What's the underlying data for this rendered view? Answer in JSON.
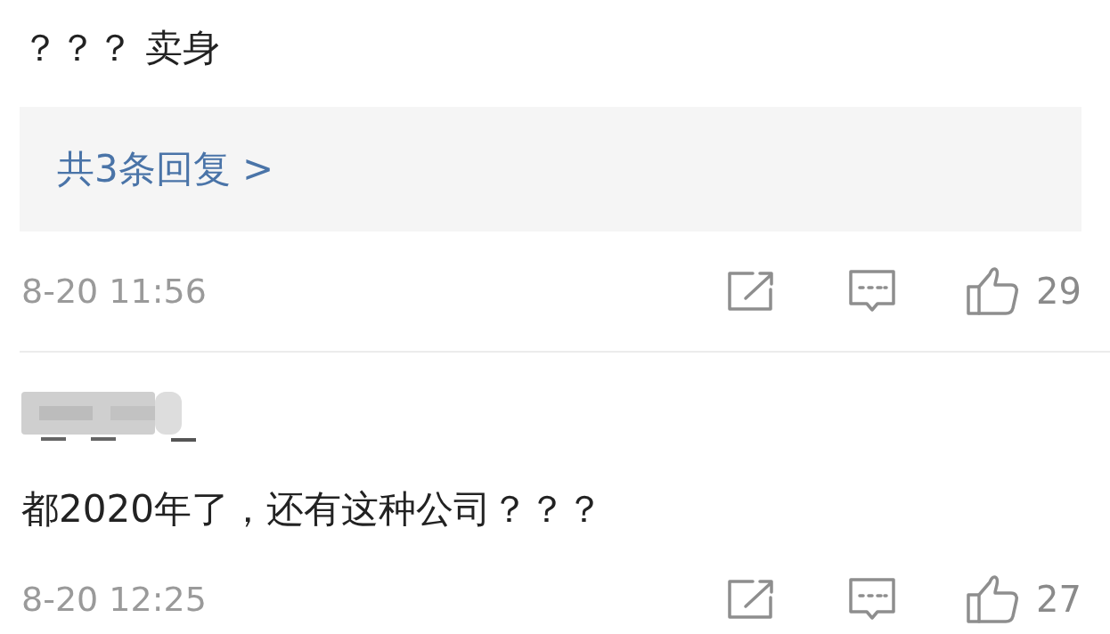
{
  "comments": [
    {
      "text": "？？？ 卖身",
      "replies_link": "共3条回复 >",
      "time": "8-20 11:56",
      "likes": "29"
    },
    {
      "author_redacted": true,
      "text": "都2020年了，还有这种公司？？？",
      "time": "8-20 12:25",
      "likes": "27"
    }
  ]
}
